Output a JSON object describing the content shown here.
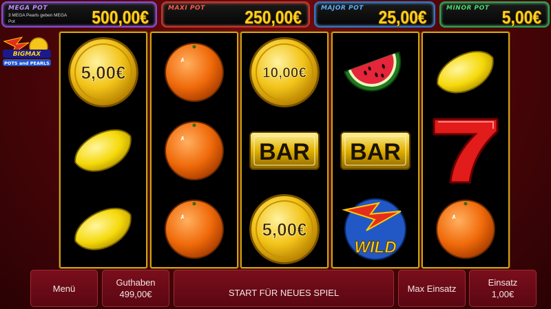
{
  "jackpots": {
    "mega": {
      "name": "MEGA POT",
      "value": "500,00€",
      "note": "3 MEGA Pearls geben MEGA Pot"
    },
    "maxi": {
      "name": "MAXI POT",
      "value": "250,00€"
    },
    "major": {
      "name": "MAJOR POT",
      "value": "25,00€"
    },
    "minor": {
      "name": "MINOR POT",
      "value": "5,00€"
    }
  },
  "logo": {
    "line1": "BIGMAX",
    "line2": "POTS and PEARLS"
  },
  "reels": [
    [
      "coin-5",
      "lemon",
      "lemon"
    ],
    [
      "orange",
      "orange",
      "orange"
    ],
    [
      "coin-10",
      "bar",
      "coin-5"
    ],
    [
      "watermelon",
      "bar",
      "wild"
    ],
    [
      "lemon",
      "seven",
      "orange"
    ]
  ],
  "symbol_text": {
    "coin_5": "5,00€",
    "coin_10": "10,00€",
    "bar": "BAR",
    "wild": "WILD"
  },
  "controls": {
    "menu_label": "Menü",
    "balance_label": "Guthaben",
    "balance_value": "499,00€",
    "start_label": "START FÜR NEUES SPIEL",
    "maxbet_label": "Max Einsatz",
    "bet_label": "Einsatz",
    "bet_value": "1,00€"
  },
  "colors": {
    "background": "#4a0508",
    "reel_border": "#d4a017",
    "button": "#6a0a16",
    "jackpot_value": "#ffd21a"
  }
}
